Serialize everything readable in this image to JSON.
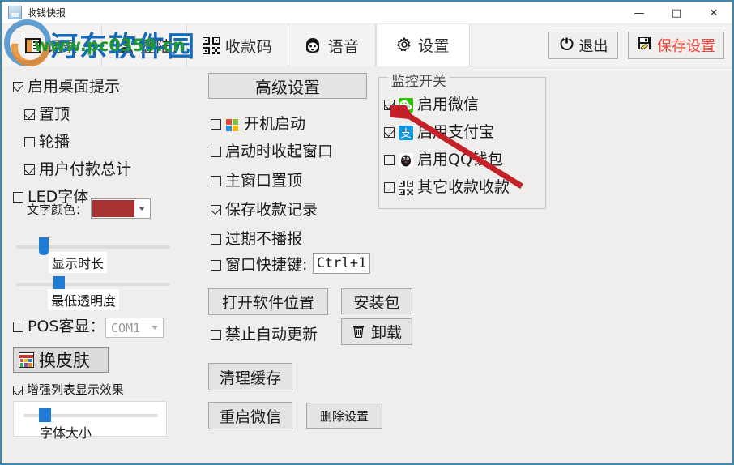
{
  "window": {
    "title": "收钱快报",
    "icon": "app-icon",
    "minimize": "—",
    "maximize": "□",
    "close": "✕"
  },
  "watermark": {
    "brand": "河东软件园",
    "url": "www.pc0359.cn"
  },
  "tabs": [
    {
      "label": "记录",
      "icon": "list-icon",
      "active": false
    },
    {
      "label": "登陆",
      "icon": "person-icon",
      "active": false
    },
    {
      "label": "收款码",
      "icon": "qrcode-icon",
      "active": false
    },
    {
      "label": "语音",
      "icon": "voice-icon",
      "active": false
    },
    {
      "label": "设置",
      "icon": "gear-icon",
      "active": true
    }
  ],
  "toolbar": {
    "exit_label": "退出",
    "exit_icon": "power-icon",
    "save_label": "保存设置",
    "save_icon": "floppy-disk-icon",
    "save_color": "#f1453d"
  },
  "left_panel": {
    "desktop_tip": {
      "label": "启用桌面提示",
      "checked": true
    },
    "always_on_top": {
      "label": "置顶",
      "checked": true
    },
    "rotate": {
      "label": "轮播",
      "checked": false
    },
    "user_pay_total": {
      "label": "用户付款总计",
      "checked": true
    },
    "led_font": {
      "label": "LED字体",
      "checked": false
    },
    "text_color_label": "文字颜色：",
    "text_color_value": "#a83232",
    "slider_duration": {
      "caption": "显示时长",
      "value": 18
    },
    "slider_opacity": {
      "caption": "最低透明度",
      "value": 28
    },
    "pos_display": {
      "label": "POS客显：",
      "checked": false
    },
    "pos_port_value": "COM1",
    "skin_button": {
      "label": "换皮肤",
      "icon": "palette-icon"
    },
    "enhance_list": {
      "label": "增强列表显示效果",
      "checked": true
    },
    "slider_fontsize": {
      "caption": "字体大小",
      "value": 16
    }
  },
  "middle_panel": {
    "advanced_button": "高级设置",
    "boot_start": {
      "label": "开机启动",
      "checked": false,
      "icon": "windows-icon"
    },
    "start_minimized": {
      "label": "启动时收起窗口",
      "checked": false
    },
    "main_on_top": {
      "label": "主窗口置顶",
      "checked": false
    },
    "save_records": {
      "label": "保存收款记录",
      "checked": true
    },
    "no_expire_voice": {
      "label": "过期不播报",
      "checked": false
    },
    "hotkey": {
      "label": "窗口快捷键:",
      "checked": false,
      "value": "Ctrl+1"
    },
    "open_location": "打开软件位置",
    "installer": "安装包",
    "no_auto_update": {
      "label": "禁止自动更新",
      "checked": false
    },
    "uninstall": {
      "label": "卸载",
      "icon": "trash-icon"
    },
    "clear_cache": "清理缓存",
    "restart_wechat": "重启微信",
    "delete_settings": "删除设置"
  },
  "monitor_group": {
    "title": "监控开关",
    "items": [
      {
        "label": "启用微信",
        "checked": true,
        "icon": "wechat-icon"
      },
      {
        "label": "启用支付宝",
        "checked": true,
        "icon": "alipay-icon"
      },
      {
        "label": "启用QQ钱包",
        "checked": false,
        "icon": "qq-icon"
      },
      {
        "label": "其它收款收款",
        "checked": false,
        "icon": "qrcode-icon"
      }
    ]
  },
  "annotation": {
    "arrow": "red-arrow",
    "color": "#c42027"
  }
}
